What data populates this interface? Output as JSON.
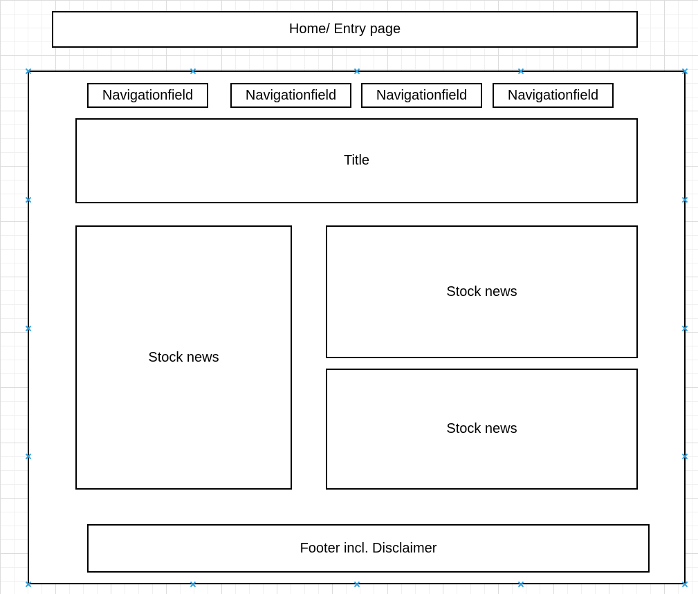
{
  "home": {
    "label": "Home/ Entry page"
  },
  "navigation": {
    "items": [
      {
        "label": "Navigationfield"
      },
      {
        "label": "Navigationfield"
      },
      {
        "label": "Navigationfield"
      },
      {
        "label": "Navigationfield"
      }
    ]
  },
  "title": {
    "label": "Title"
  },
  "news": {
    "large": {
      "label": "Stock news"
    },
    "top_right": {
      "label": "Stock news"
    },
    "bottom_right": {
      "label": "Stock news"
    }
  },
  "footer": {
    "label": "Footer incl. Disclaimer"
  },
  "colors": {
    "stroke": "#000000",
    "selection_handle": "#29a3e6",
    "grid": "#dcdcdc"
  }
}
